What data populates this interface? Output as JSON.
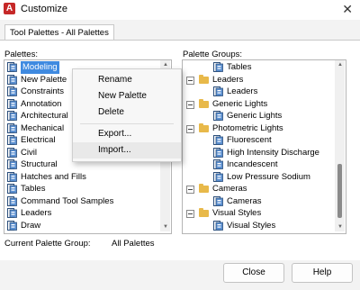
{
  "window": {
    "title": "Customize",
    "close_glyph": "✕",
    "app_icon_letter": "A"
  },
  "tab": {
    "label": "Tool Palettes - All Palettes"
  },
  "palettes": {
    "label": "Palettes:",
    "items": [
      "Modeling",
      "New Palette",
      "Constraints",
      "Annotation",
      "Architectural",
      "Mechanical",
      "Electrical",
      "Civil",
      "Structural",
      "Hatches and Fills",
      "Tables",
      "Command Tool Samples",
      "Leaders",
      "Draw"
    ],
    "selected_index": 0,
    "scroll_fraction": 0.22
  },
  "palette_groups": {
    "label": "Palette Groups:",
    "items": [
      {
        "label": "Tables",
        "type": "palette",
        "level": 1
      },
      {
        "label": "Leaders",
        "type": "group",
        "level": 0
      },
      {
        "label": "Leaders",
        "type": "palette",
        "level": 1
      },
      {
        "label": "Generic Lights",
        "type": "group",
        "level": 0
      },
      {
        "label": "Generic Lights",
        "type": "palette",
        "level": 1
      },
      {
        "label": "Photometric Lights",
        "type": "group",
        "level": 0
      },
      {
        "label": "Fluorescent",
        "type": "palette",
        "level": 1
      },
      {
        "label": "High Intensity Discharge",
        "type": "palette",
        "level": 1
      },
      {
        "label": "Incandescent",
        "type": "palette",
        "level": 1
      },
      {
        "label": "Low Pressure Sodium",
        "type": "palette",
        "level": 1
      },
      {
        "label": "Cameras",
        "type": "group",
        "level": 0
      },
      {
        "label": "Cameras",
        "type": "palette",
        "level": 1
      },
      {
        "label": "Visual Styles",
        "type": "group",
        "level": 0
      },
      {
        "label": "Visual Styles",
        "type": "palette",
        "level": 1
      }
    ],
    "scroll_fraction": 0.95
  },
  "context_menu": {
    "items": [
      {
        "label": "Rename"
      },
      {
        "label": "New Palette"
      },
      {
        "label": "Delete"
      },
      {
        "label": "Export..."
      },
      {
        "label": "Import..."
      }
    ],
    "hovered_index": 4
  },
  "footer": {
    "current_group_label": "Current Palette Group:",
    "current_group_value": "All Palettes"
  },
  "buttons": {
    "close": "Close",
    "help": "Help"
  },
  "colors": {
    "selection": "#3f8ae0",
    "folder": "#e8b94a",
    "app_icon": "#c62828"
  }
}
